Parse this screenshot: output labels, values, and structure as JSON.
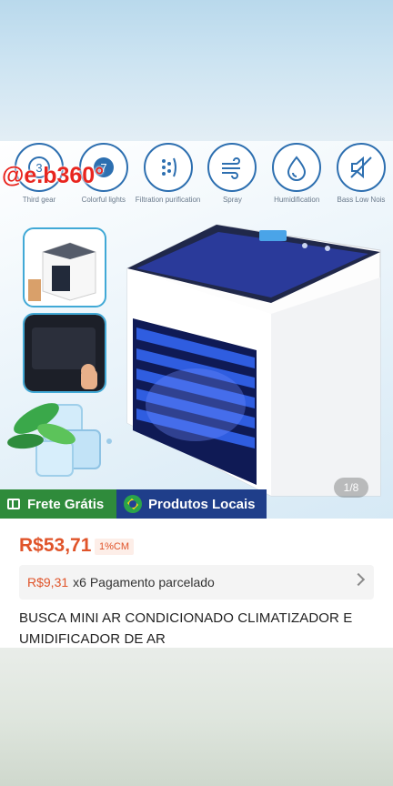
{
  "watermark": "@e.b360°",
  "features": [
    {
      "label": "Third gear",
      "icon": "fan-speed-icon"
    },
    {
      "label": "Colorful lights",
      "icon": "color-light-icon"
    },
    {
      "label": "Filtration purification",
      "icon": "filter-icon"
    },
    {
      "label": "Spray",
      "icon": "spray-icon"
    },
    {
      "label": "Humidification",
      "icon": "water-drop-icon"
    },
    {
      "label": "Bass Low Nois",
      "icon": "mute-speaker-icon"
    }
  ],
  "gallery": {
    "counter": "1/8"
  },
  "badges": {
    "free_shipping": "Frete Grátis",
    "local_products": "Produtos Locais"
  },
  "product": {
    "price": "R$53,71",
    "cashback": "1%CM",
    "installment_price": "R$9,31",
    "installment_text": "x6 Pagamento parcelado",
    "title": "BUSCA MINI AR CONDICIONADO CLIMATIZADOR E UMIDIFICADOR DE AR"
  },
  "colors": {
    "accent": "#e0542a",
    "free_shipping_bg": "#2f8b3b",
    "local_bg": "#1f3e8a"
  }
}
